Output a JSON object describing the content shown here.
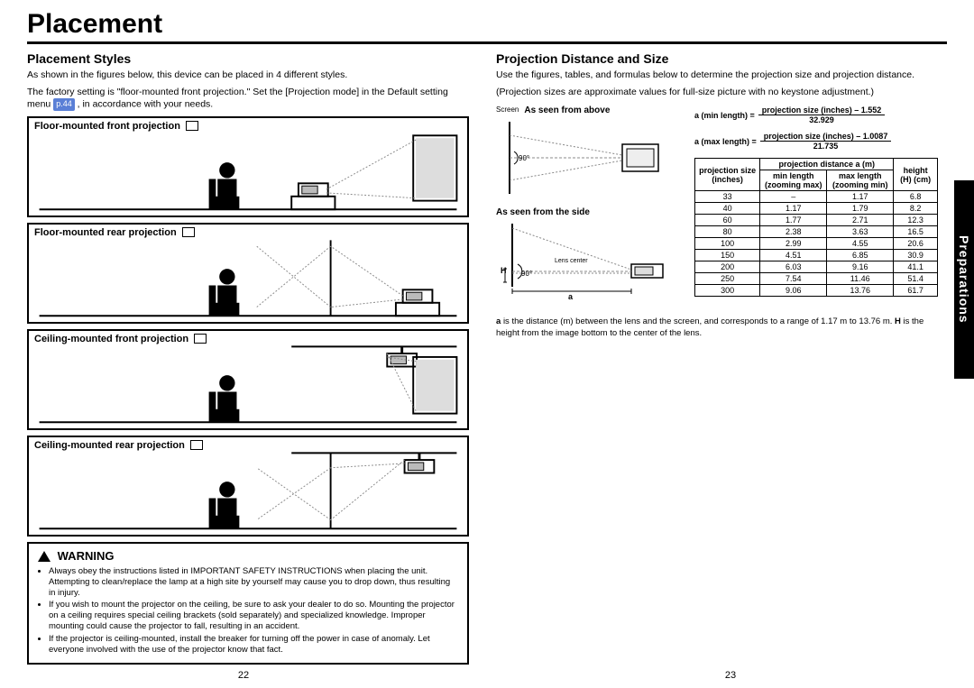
{
  "page_title": "Placement",
  "side_tab": "Preparations",
  "page_left_num": "22",
  "page_right_num": "23",
  "left": {
    "heading": "Placement Styles",
    "intro_1": "As shown in the figures below, this device can be placed in 4 different styles.",
    "intro_2a": "The factory setting is \"floor-mounted front projection.\" Set the [Projection mode] in the Default setting menu ",
    "ref_badge": "p.44",
    "intro_2b": " , in accordance with your needs.",
    "styles": [
      "Floor-mounted front projection",
      "Floor-mounted rear projection",
      "Ceiling-mounted front projection",
      "Ceiling-mounted rear projection"
    ],
    "warning_heading": "WARNING",
    "warnings": [
      "Always obey the instructions listed in IMPORTANT SAFETY INSTRUCTIONS when placing the unit. Attempting to clean/replace the lamp at a high site by yourself may cause you to drop down, thus resulting in injury.",
      "If you wish to mount the projector on the ceiling, be sure to ask your dealer to do so. Mounting the projector on a ceiling requires special ceiling brackets (sold separately) and specialized knowledge. Improper mounting could cause the projector to fall, resulting in an accident.",
      "If the projector is ceiling-mounted, install the breaker for turning off the power in case of anomaly. Let everyone involved with the use of the projector know that fact."
    ]
  },
  "right": {
    "heading": "Projection Distance and Size",
    "intro_1": "Use the figures, tables, and formulas below to determine the projection size and projection distance.",
    "intro_2": "(Projection sizes are approximate values for full-size picture with no keystone adjustment.)",
    "above_label": "As seen from above",
    "side_label": "As seen from the side",
    "screen_label": "Screen",
    "lens_center": "Lens center",
    "angle_label": "90°",
    "a_label": "a",
    "h_label": "H",
    "formula_min_label": "a (min length) =",
    "formula_min_num": "projection size (inches) – 1.552",
    "formula_min_den": "32.929",
    "formula_max_label": "a (max length) =",
    "formula_max_num": "projection size (inches) – 1.0087",
    "formula_max_den": "21.735",
    "table_head_proj": "projection size (inches)",
    "table_head_dist": "projection distance a (m)",
    "table_head_min": "min length (zooming max)",
    "table_head_max": "max length (zooming min)",
    "table_head_h": "height (H) (cm)",
    "chart_data": {
      "type": "table",
      "columns": [
        "projection_size_in",
        "min_length_m",
        "max_length_m",
        "height_cm"
      ],
      "rows": [
        {
          "size": "33",
          "min": "–",
          "max": "1.17",
          "h": "6.8"
        },
        {
          "size": "40",
          "min": "1.17",
          "max": "1.79",
          "h": "8.2"
        },
        {
          "size": "60",
          "min": "1.77",
          "max": "2.71",
          "h": "12.3"
        },
        {
          "size": "80",
          "min": "2.38",
          "max": "3.63",
          "h": "16.5"
        },
        {
          "size": "100",
          "min": "2.99",
          "max": "4.55",
          "h": "20.6"
        },
        {
          "size": "150",
          "min": "4.51",
          "max": "6.85",
          "h": "30.9"
        },
        {
          "size": "200",
          "min": "6.03",
          "max": "9.16",
          "h": "41.1"
        },
        {
          "size": "250",
          "min": "7.54",
          "max": "11.46",
          "h": "51.4"
        },
        {
          "size": "300",
          "min": "9.06",
          "max": "13.76",
          "h": "61.7"
        }
      ]
    },
    "footnote": "a is the distance (m) between the lens and the screen, and corresponds to a range of 1.17 m to 13.76 m. H is the height from the image bottom to the center of the lens.",
    "footnote_bold_a": "a",
    "footnote_bold_h": "H"
  }
}
